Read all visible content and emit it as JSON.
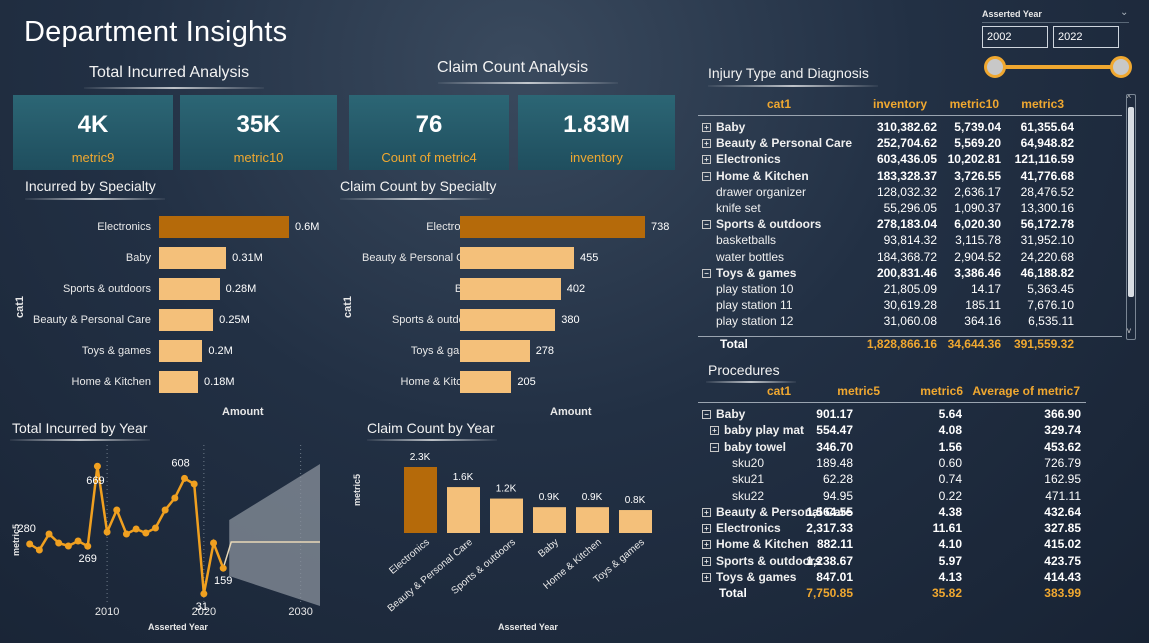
{
  "page": {
    "title": "Department Insights"
  },
  "sections": {
    "total_incurred": "Total Incurred Analysis",
    "claim_count": "Claim Count Analysis",
    "injury_type": "Injury Type and Diagnosis",
    "procedures": "Procedures"
  },
  "kpis": [
    {
      "value": "4K",
      "label": "metric9"
    },
    {
      "value": "35K",
      "label": "metric10"
    },
    {
      "value": "76",
      "label": "Count of metric4"
    },
    {
      "value": "1.83M",
      "label": "inventory"
    }
  ],
  "slicer": {
    "title": "Asserted Year",
    "from": "2002",
    "to": "2022",
    "chevron": "chevron-down-icon"
  },
  "incurred_by_specialty": {
    "title": "Incurred by Specialty",
    "ylabel": "cat1",
    "xlabel": "Amount"
  },
  "claim_by_specialty": {
    "title": "Claim Count by Specialty",
    "ylabel": "cat1",
    "xlabel": "Amount"
  },
  "incurred_by_year": {
    "title": "Total Incurred by Year",
    "ylabel": "metric5",
    "xlabel": "Asserted Year",
    "ticks": [
      "2010",
      "2020",
      "2030"
    ]
  },
  "claim_by_year": {
    "title": "Claim Count by Year",
    "ylabel": "metric5",
    "xlabel": "Asserted Year"
  },
  "chart_data": [
    {
      "type": "bar",
      "orientation": "horizontal",
      "title": "Incurred by Specialty",
      "ylabel": "cat1",
      "xlabel": "Amount",
      "categories": [
        "Electronics",
        "Baby",
        "Sports & outdoors",
        "Beauty & Personal Care",
        "Toys & games",
        "Home & Kitchen"
      ],
      "values": [
        0.6,
        0.31,
        0.28,
        0.25,
        0.2,
        0.18
      ],
      "labels": [
        "0.6M",
        "0.31M",
        "0.28M",
        "0.25M",
        "0.2M",
        "0.18M"
      ],
      "xlim": [
        0,
        0.6
      ]
    },
    {
      "type": "bar",
      "orientation": "horizontal",
      "title": "Claim Count by Specialty",
      "ylabel": "cat1",
      "xlabel": "Amount",
      "categories": [
        "Electronics",
        "Beauty & Personal Care",
        "Baby",
        "Sports & outdoors",
        "Toys & games",
        "Home & Kitchen"
      ],
      "values": [
        738,
        455,
        402,
        380,
        278,
        205
      ],
      "labels": [
        "738",
        "455",
        "402",
        "380",
        "278",
        "205"
      ],
      "xlim": [
        0,
        738
      ]
    },
    {
      "type": "line",
      "title": "Total Incurred by Year",
      "xlabel": "Asserted Year",
      "ylabel": "metric5",
      "x": [
        2002,
        2003,
        2004,
        2005,
        2006,
        2007,
        2008,
        2009,
        2010,
        2011,
        2012,
        2013,
        2014,
        2015,
        2016,
        2017,
        2018,
        2019,
        2020,
        2021,
        2022
      ],
      "values": [
        280,
        250,
        330,
        285,
        270,
        295,
        269,
        669,
        340,
        450,
        330,
        355,
        335,
        360,
        450,
        510,
        608,
        580,
        31,
        285,
        159
      ],
      "annotations": [
        {
          "x": 2002,
          "label": "280"
        },
        {
          "x": 2008,
          "label": "269"
        },
        {
          "x": 2009,
          "label": "669"
        },
        {
          "x": 2018,
          "label": "608"
        },
        {
          "x": 2020,
          "label": "31"
        },
        {
          "x": 2022,
          "label": "159"
        }
      ],
      "xlim": [
        2001,
        2032
      ],
      "xticks": [
        2010,
        2020,
        2030
      ],
      "forecast": true
    },
    {
      "type": "bar",
      "title": "Claim Count by Year",
      "xlabel": "Asserted Year",
      "ylabel": "metric5",
      "categories": [
        "Electronics",
        "Beauty & Personal Care",
        "Sports & outdoors",
        "Baby",
        "Home & Kitchen",
        "Toys & games"
      ],
      "values": [
        2.3,
        1.6,
        1.2,
        0.9,
        0.9,
        0.8
      ],
      "labels": [
        "2.3K",
        "1.6K",
        "1.2K",
        "0.9K",
        "0.9K",
        "0.8K"
      ]
    }
  ],
  "injury_table": {
    "columns": [
      "cat1",
      "inventory",
      "metric10",
      "metric3"
    ],
    "rows": [
      {
        "expander": "⊞",
        "name": "Baby",
        "level": 0,
        "bold": true,
        "v": [
          "310,382.62",
          "5,739.04",
          "61,355.64"
        ]
      },
      {
        "expander": "⊞",
        "name": "Beauty & Personal Care",
        "level": 0,
        "bold": true,
        "v": [
          "252,704.62",
          "5,569.20",
          "64,948.82"
        ]
      },
      {
        "expander": "⊞",
        "name": "Electronics",
        "level": 0,
        "bold": true,
        "v": [
          "603,436.05",
          "10,202.81",
          "121,116.59"
        ]
      },
      {
        "expander": "⊟",
        "name": "Home & Kitchen",
        "level": 0,
        "bold": true,
        "v": [
          "183,328.37",
          "3,726.55",
          "41,776.68"
        ]
      },
      {
        "expander": "",
        "name": "drawer organizer",
        "level": 1,
        "bold": false,
        "v": [
          "128,032.32",
          "2,636.17",
          "28,476.52"
        ]
      },
      {
        "expander": "",
        "name": "knife set",
        "level": 1,
        "bold": false,
        "v": [
          "55,296.05",
          "1,090.37",
          "13,300.16"
        ]
      },
      {
        "expander": "⊟",
        "name": "Sports & outdoors",
        "level": 0,
        "bold": true,
        "v": [
          "278,183.04",
          "6,020.30",
          "56,172.78"
        ]
      },
      {
        "expander": "",
        "name": "basketballs",
        "level": 1,
        "bold": false,
        "v": [
          "93,814.32",
          "3,115.78",
          "31,952.10"
        ]
      },
      {
        "expander": "",
        "name": "water bottles",
        "level": 1,
        "bold": false,
        "v": [
          "184,368.72",
          "2,904.52",
          "24,220.68"
        ]
      },
      {
        "expander": "⊟",
        "name": "Toys & games",
        "level": 0,
        "bold": true,
        "v": [
          "200,831.46",
          "3,386.46",
          "46,188.82"
        ]
      },
      {
        "expander": "",
        "name": "play station 10",
        "level": 1,
        "bold": false,
        "v": [
          "21,805.09",
          "14.17",
          "5,363.45"
        ]
      },
      {
        "expander": "",
        "name": "play station 11",
        "level": 1,
        "bold": false,
        "v": [
          "30,619.28",
          "185.11",
          "7,676.10"
        ]
      },
      {
        "expander": "",
        "name": "play station 12",
        "level": 1,
        "bold": false,
        "v": [
          "31,060.08",
          "364.16",
          "6,535.11"
        ]
      }
    ],
    "total": {
      "name": "Total",
      "v": [
        "1,828,866.16",
        "34,644.36",
        "391,559.32"
      ]
    }
  },
  "procedures_table": {
    "columns": [
      "cat1",
      "metric5",
      "metric6",
      "Average of metric7"
    ],
    "rows": [
      {
        "expander": "⊟",
        "name": "Baby",
        "level": 0,
        "bold": true,
        "v": [
          "901.17",
          "5.64",
          "366.90"
        ]
      },
      {
        "expander": "⊞",
        "name": "baby play mat",
        "level": 1,
        "bold": true,
        "v": [
          "554.47",
          "4.08",
          "329.74"
        ]
      },
      {
        "expander": "⊟",
        "name": "baby towel",
        "level": 1,
        "bold": true,
        "v": [
          "346.70",
          "1.56",
          "453.62"
        ]
      },
      {
        "expander": "",
        "name": "sku20",
        "level": 2,
        "bold": false,
        "v": [
          "189.48",
          "0.60",
          "726.79"
        ]
      },
      {
        "expander": "",
        "name": "sku21",
        "level": 2,
        "bold": false,
        "v": [
          "62.28",
          "0.74",
          "162.95"
        ]
      },
      {
        "expander": "",
        "name": "sku22",
        "level": 2,
        "bold": false,
        "v": [
          "94.95",
          "0.22",
          "471.11"
        ]
      },
      {
        "expander": "⊞",
        "name": "Beauty & Personal Care",
        "level": 0,
        "bold": true,
        "v": [
          "1,564.55",
          "4.38",
          "432.64"
        ]
      },
      {
        "expander": "⊞",
        "name": "Electronics",
        "level": 0,
        "bold": true,
        "v": [
          "2,317.33",
          "11.61",
          "327.85"
        ]
      },
      {
        "expander": "⊞",
        "name": "Home & Kitchen",
        "level": 0,
        "bold": true,
        "v": [
          "882.11",
          "4.10",
          "415.02"
        ]
      },
      {
        "expander": "⊞",
        "name": "Sports & outdoors",
        "level": 0,
        "bold": true,
        "v": [
          "1,238.67",
          "5.97",
          "423.75"
        ]
      },
      {
        "expander": "⊞",
        "name": "Toys & games",
        "level": 0,
        "bold": true,
        "v": [
          "847.01",
          "4.13",
          "414.43"
        ]
      }
    ],
    "total": {
      "name": "Total",
      "v": [
        "7,750.85",
        "35.82",
        "383.99"
      ]
    }
  },
  "colors": {
    "accent": "#f0a830",
    "bar_highlight": "#b56a0a",
    "bar_light": "#f4c07a",
    "kpi_bg": "#2a6171",
    "line": "#f0a020"
  }
}
